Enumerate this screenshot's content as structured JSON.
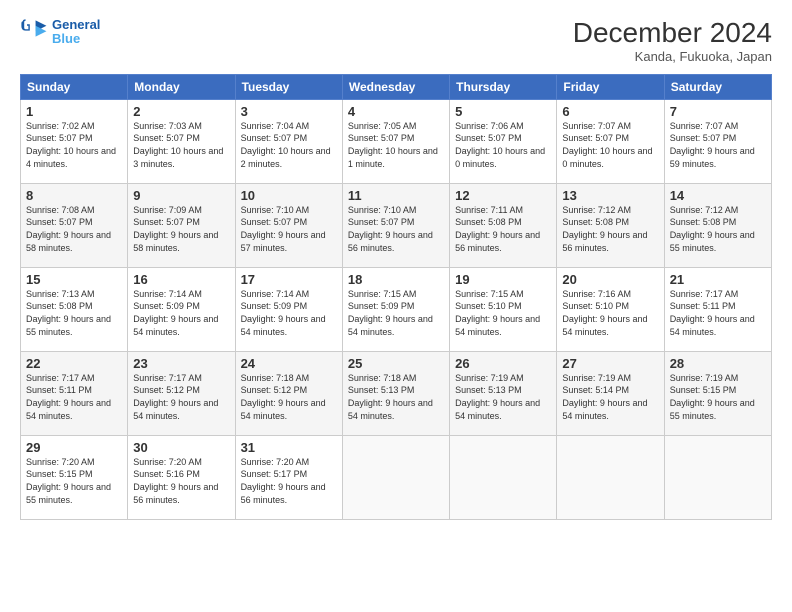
{
  "header": {
    "logo_line1": "General",
    "logo_line2": "Blue",
    "main_title": "December 2024",
    "subtitle": "Kanda, Fukuoka, Japan"
  },
  "weekdays": [
    "Sunday",
    "Monday",
    "Tuesday",
    "Wednesday",
    "Thursday",
    "Friday",
    "Saturday"
  ],
  "weeks": [
    [
      {
        "day": "1",
        "sunrise": "7:02 AM",
        "sunset": "5:07 PM",
        "daylight": "10 hours and 4 minutes."
      },
      {
        "day": "2",
        "sunrise": "7:03 AM",
        "sunset": "5:07 PM",
        "daylight": "10 hours and 3 minutes."
      },
      {
        "day": "3",
        "sunrise": "7:04 AM",
        "sunset": "5:07 PM",
        "daylight": "10 hours and 2 minutes."
      },
      {
        "day": "4",
        "sunrise": "7:05 AM",
        "sunset": "5:07 PM",
        "daylight": "10 hours and 1 minute."
      },
      {
        "day": "5",
        "sunrise": "7:06 AM",
        "sunset": "5:07 PM",
        "daylight": "10 hours and 0 minutes."
      },
      {
        "day": "6",
        "sunrise": "7:07 AM",
        "sunset": "5:07 PM",
        "daylight": "10 hours and 0 minutes."
      },
      {
        "day": "7",
        "sunrise": "7:07 AM",
        "sunset": "5:07 PM",
        "daylight": "9 hours and 59 minutes."
      }
    ],
    [
      {
        "day": "8",
        "sunrise": "7:08 AM",
        "sunset": "5:07 PM",
        "daylight": "9 hours and 58 minutes."
      },
      {
        "day": "9",
        "sunrise": "7:09 AM",
        "sunset": "5:07 PM",
        "daylight": "9 hours and 58 minutes."
      },
      {
        "day": "10",
        "sunrise": "7:10 AM",
        "sunset": "5:07 PM",
        "daylight": "9 hours and 57 minutes."
      },
      {
        "day": "11",
        "sunrise": "7:10 AM",
        "sunset": "5:07 PM",
        "daylight": "9 hours and 56 minutes."
      },
      {
        "day": "12",
        "sunrise": "7:11 AM",
        "sunset": "5:08 PM",
        "daylight": "9 hours and 56 minutes."
      },
      {
        "day": "13",
        "sunrise": "7:12 AM",
        "sunset": "5:08 PM",
        "daylight": "9 hours and 56 minutes."
      },
      {
        "day": "14",
        "sunrise": "7:12 AM",
        "sunset": "5:08 PM",
        "daylight": "9 hours and 55 minutes."
      }
    ],
    [
      {
        "day": "15",
        "sunrise": "7:13 AM",
        "sunset": "5:08 PM",
        "daylight": "9 hours and 55 minutes."
      },
      {
        "day": "16",
        "sunrise": "7:14 AM",
        "sunset": "5:09 PM",
        "daylight": "9 hours and 54 minutes."
      },
      {
        "day": "17",
        "sunrise": "7:14 AM",
        "sunset": "5:09 PM",
        "daylight": "9 hours and 54 minutes."
      },
      {
        "day": "18",
        "sunrise": "7:15 AM",
        "sunset": "5:09 PM",
        "daylight": "9 hours and 54 minutes."
      },
      {
        "day": "19",
        "sunrise": "7:15 AM",
        "sunset": "5:10 PM",
        "daylight": "9 hours and 54 minutes."
      },
      {
        "day": "20",
        "sunrise": "7:16 AM",
        "sunset": "5:10 PM",
        "daylight": "9 hours and 54 minutes."
      },
      {
        "day": "21",
        "sunrise": "7:17 AM",
        "sunset": "5:11 PM",
        "daylight": "9 hours and 54 minutes."
      }
    ],
    [
      {
        "day": "22",
        "sunrise": "7:17 AM",
        "sunset": "5:11 PM",
        "daylight": "9 hours and 54 minutes."
      },
      {
        "day": "23",
        "sunrise": "7:17 AM",
        "sunset": "5:12 PM",
        "daylight": "9 hours and 54 minutes."
      },
      {
        "day": "24",
        "sunrise": "7:18 AM",
        "sunset": "5:12 PM",
        "daylight": "9 hours and 54 minutes."
      },
      {
        "day": "25",
        "sunrise": "7:18 AM",
        "sunset": "5:13 PM",
        "daylight": "9 hours and 54 minutes."
      },
      {
        "day": "26",
        "sunrise": "7:19 AM",
        "sunset": "5:13 PM",
        "daylight": "9 hours and 54 minutes."
      },
      {
        "day": "27",
        "sunrise": "7:19 AM",
        "sunset": "5:14 PM",
        "daylight": "9 hours and 54 minutes."
      },
      {
        "day": "28",
        "sunrise": "7:19 AM",
        "sunset": "5:15 PM",
        "daylight": "9 hours and 55 minutes."
      }
    ],
    [
      {
        "day": "29",
        "sunrise": "7:20 AM",
        "sunset": "5:15 PM",
        "daylight": "9 hours and 55 minutes."
      },
      {
        "day": "30",
        "sunrise": "7:20 AM",
        "sunset": "5:16 PM",
        "daylight": "9 hours and 56 minutes."
      },
      {
        "day": "31",
        "sunrise": "7:20 AM",
        "sunset": "5:17 PM",
        "daylight": "9 hours and 56 minutes."
      },
      null,
      null,
      null,
      null
    ]
  ],
  "labels": {
    "sunrise": "Sunrise:",
    "sunset": "Sunset:",
    "daylight": "Daylight:"
  }
}
